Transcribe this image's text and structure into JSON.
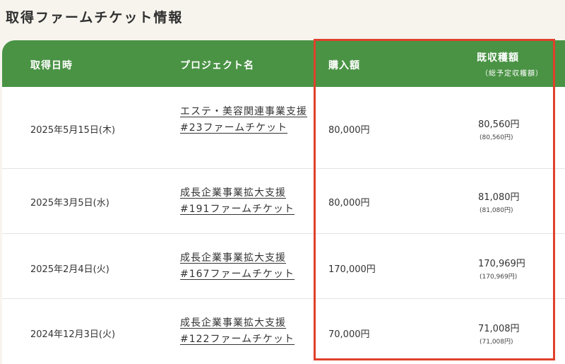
{
  "page": {
    "title": "取得ファームチケット情報"
  },
  "table": {
    "headers": {
      "date": "取得日時",
      "project": "プロジェクト名",
      "purchase": "購入額",
      "yield": "既収穫額",
      "yield_sub": "（総予定収穫額）"
    },
    "rows": [
      {
        "date": "2025年5月15日(木)",
        "project": "エステ・美容関連事業支援#23ファームチケット",
        "purchase": "80,000円",
        "yield": "80,560円",
        "yield_total": "(80,560円)"
      },
      {
        "date": "2025年3月5日(水)",
        "project": "成長企業事業拡大支援#191ファームチケット",
        "purchase": "80,000円",
        "yield": "81,080円",
        "yield_total": "(81,080円)"
      },
      {
        "date": "2025年2月4日(火)",
        "project": "成長企業事業拡大支援#167ファームチケット",
        "purchase": "170,000円",
        "yield": "170,969円",
        "yield_total": "(170,969円)"
      },
      {
        "date": "2024年12月3日(火)",
        "project": "成長企業事業拡大支援#122ファームチケット",
        "purchase": "70,000円",
        "yield": "71,008円",
        "yield_total": "(71,008円)"
      }
    ]
  },
  "colors": {
    "header_green": "#4a9345",
    "highlight_red": "#e0402b",
    "page_bg": "#f7f4ee"
  }
}
